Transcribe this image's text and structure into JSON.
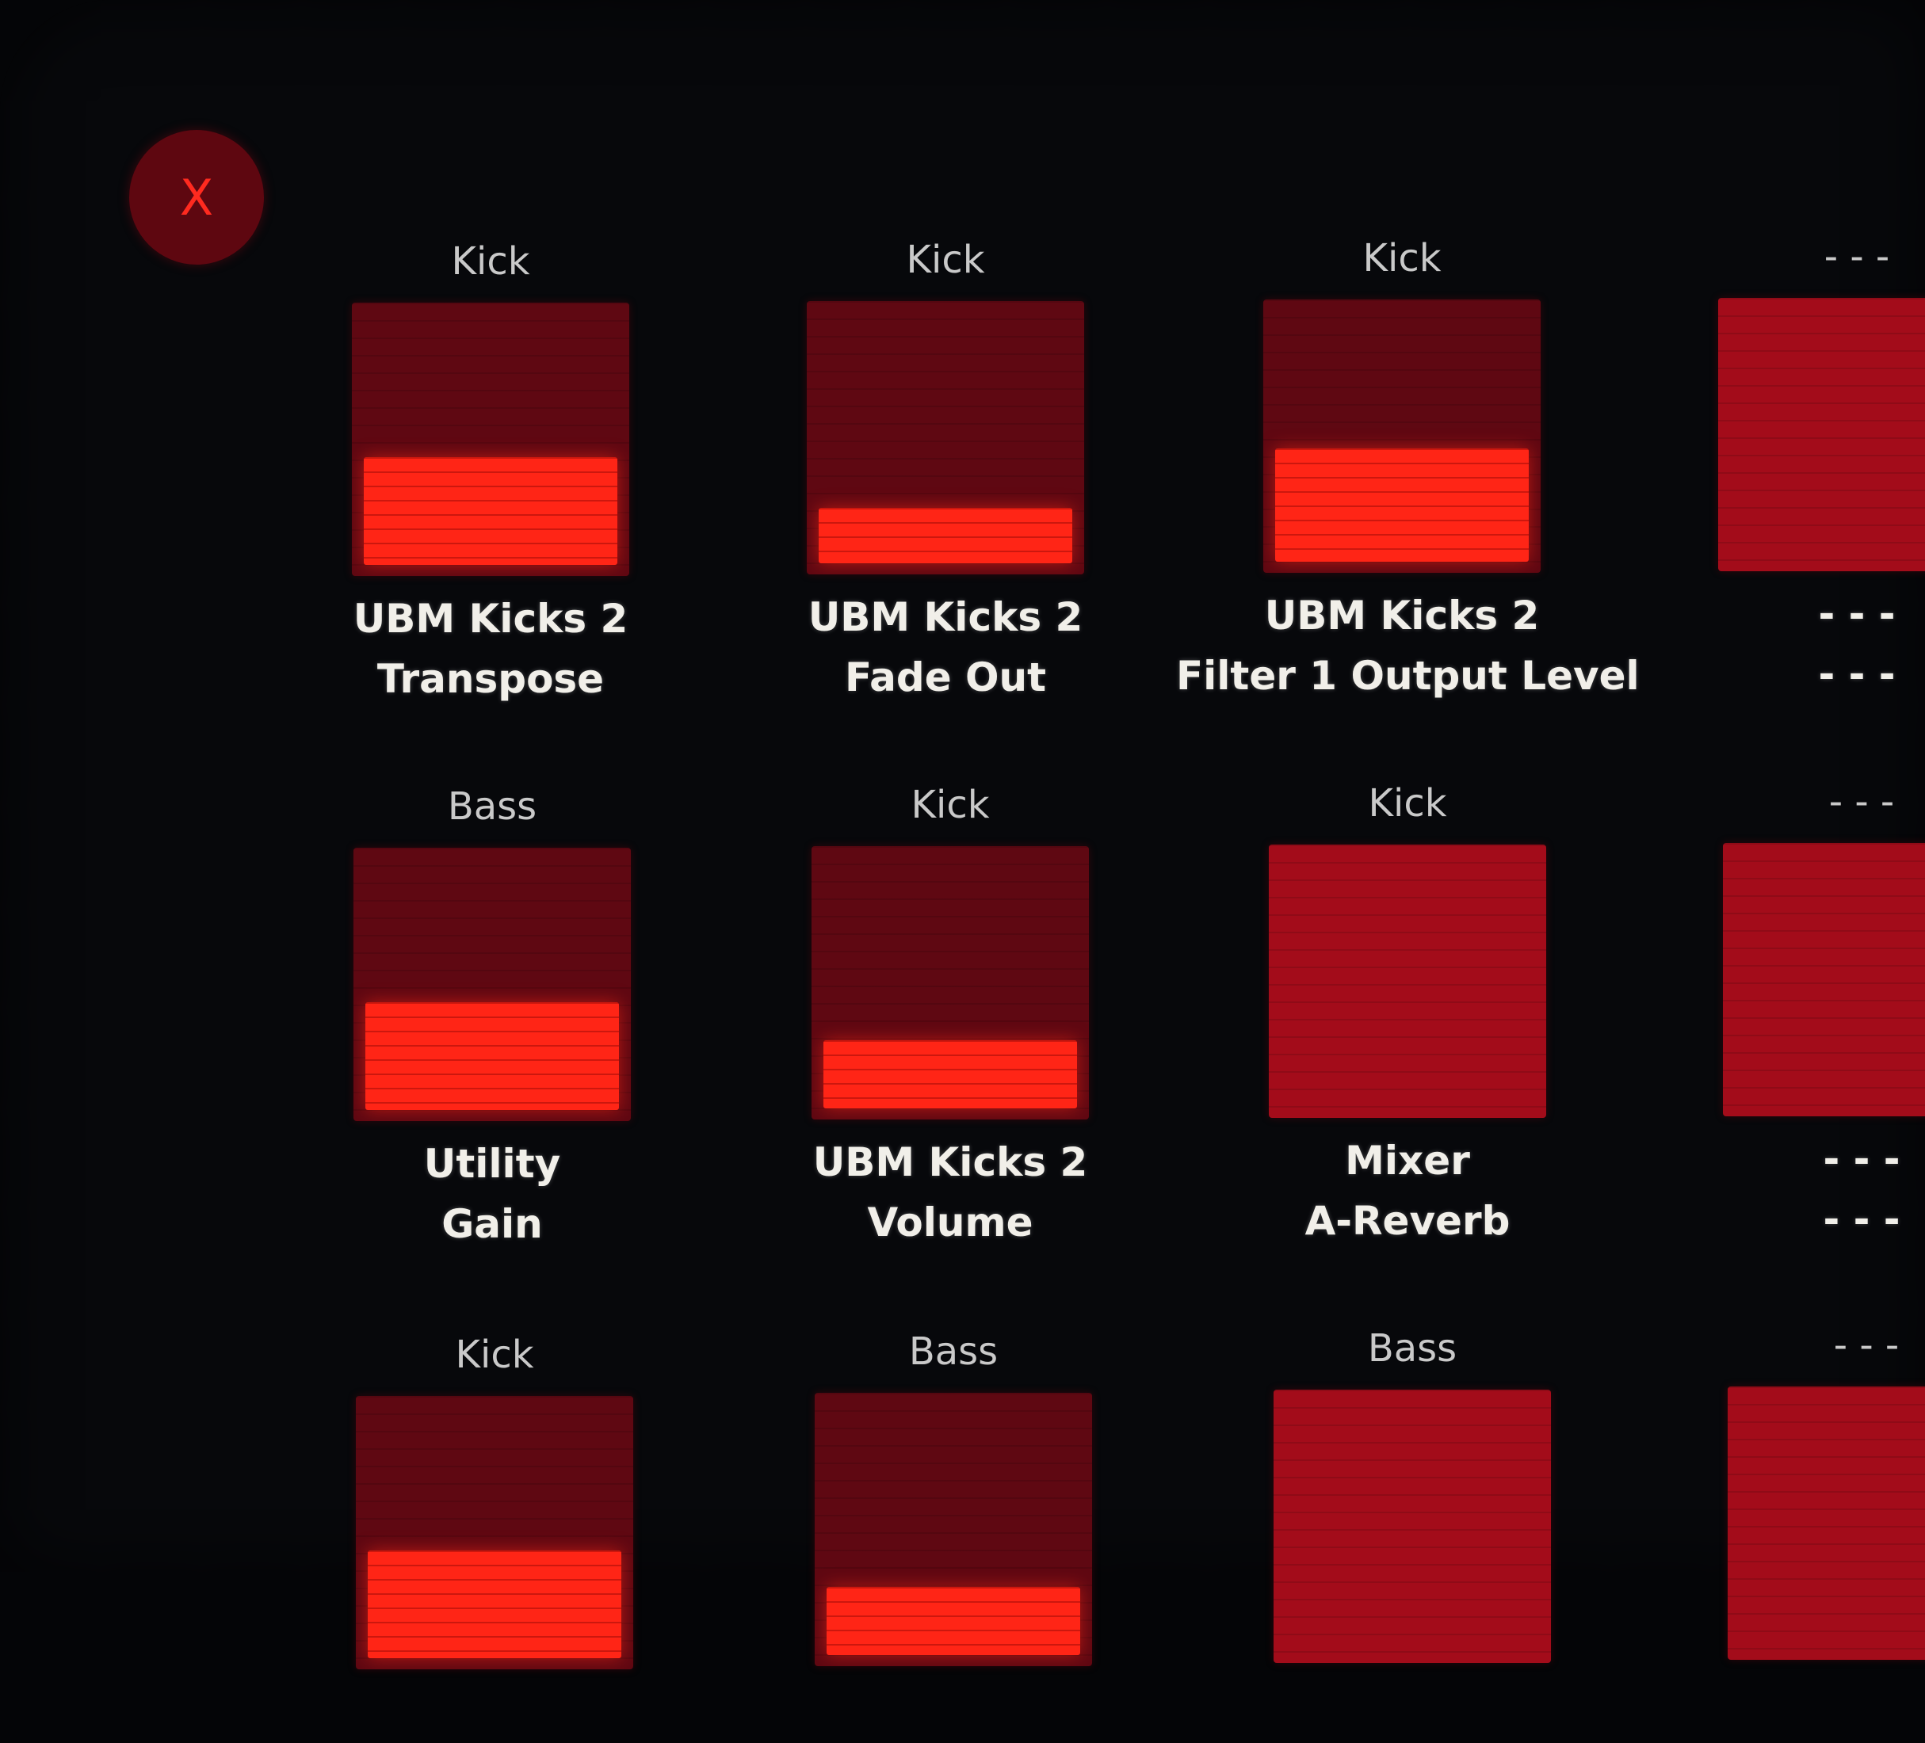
{
  "close_button": {
    "label": "X"
  },
  "colors": {
    "pad_off": "#5f0812",
    "pad_bright": "#a30c1a",
    "fill": "#ff2516",
    "text": "#f1efe9"
  },
  "rows": [
    [
      {
        "track": "Kick",
        "device": "UBM Kicks 2",
        "param": "Transpose",
        "level": 0.43
      },
      {
        "track": "Kick",
        "device": "UBM Kicks 2",
        "param": "Fade Out",
        "level": 0.22
      },
      {
        "track": "Kick",
        "device": "UBM Kicks 2",
        "param": "Filter 1 Output Level",
        "level": 0.45
      },
      {
        "track": "- - -",
        "device": "- - -",
        "param": "- - -",
        "level": 0
      }
    ],
    [
      {
        "track": "Bass",
        "device": "Utility",
        "param": "Gain",
        "level": 0.43
      },
      {
        "track": "Kick",
        "device": "UBM Kicks 2",
        "param": "Volume",
        "level": 0.27
      },
      {
        "track": "Kick",
        "device": "Mixer",
        "param": "A-Reverb",
        "level": 0
      },
      {
        "track": "- - -",
        "device": "- - -",
        "param": "- - -",
        "level": 0
      }
    ],
    [
      {
        "track": "Kick",
        "device": "",
        "param": "",
        "level": 0.43
      },
      {
        "track": "Bass",
        "device": "",
        "param": "",
        "level": 0.27
      },
      {
        "track": "Bass",
        "device": "",
        "param": "",
        "level": 0
      },
      {
        "track": "- - -",
        "device": "",
        "param": "",
        "level": 0
      }
    ]
  ]
}
